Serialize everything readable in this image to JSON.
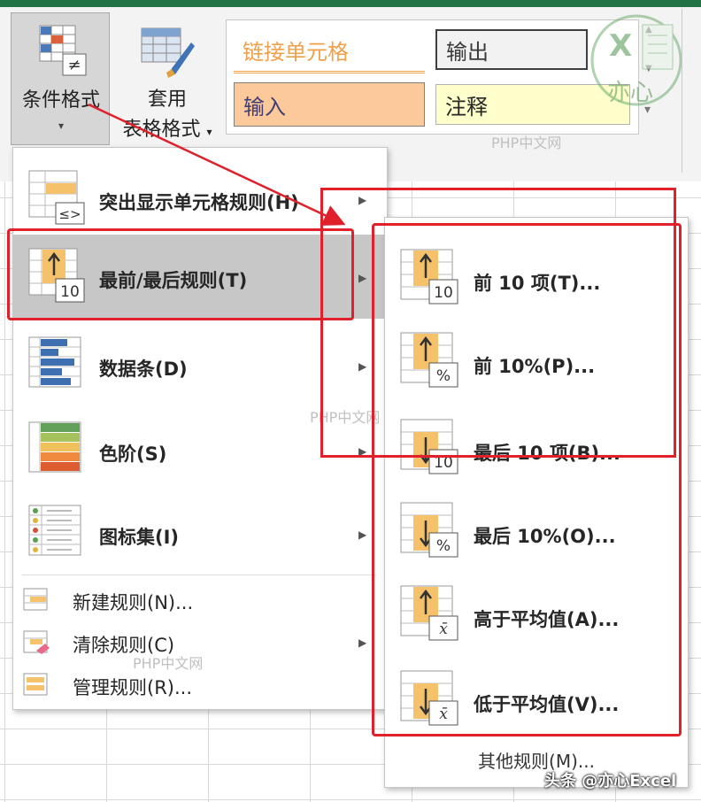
{
  "ribbon": {
    "conditional_format_label": "条件格式",
    "table_format_label_1": "套用",
    "table_format_label_2": "表格格式",
    "dropdown_caret": "▾",
    "styles": [
      {
        "label": "链接单元格",
        "bg": "#ffffff",
        "color": "#f4a34b"
      },
      {
        "label": "输出",
        "bg": "#f2f2f2",
        "color": "#3a3a3a"
      },
      {
        "label": "输入",
        "bg": "#fbc99a",
        "color": "#3f3f76"
      },
      {
        "label": "注释",
        "bg": "#ffffcc",
        "color": "#262626"
      }
    ],
    "scroll_up": "▲",
    "scroll_down": "▼",
    "more": "▾"
  },
  "menu": {
    "items": [
      {
        "label": "突出显示单元格规则(H)",
        "icon": "highlight-cells-rules-icon",
        "has_submenu": true
      },
      {
        "label": "最前/最后规则(T)",
        "icon": "top-bottom-rules-icon",
        "has_submenu": true,
        "highlighted": true
      },
      {
        "label": "数据条(D)",
        "icon": "data-bars-icon",
        "has_submenu": true
      },
      {
        "label": "色阶(S)",
        "icon": "color-scales-icon",
        "has_submenu": true
      },
      {
        "label": "图标集(I)",
        "icon": "icon-sets-icon",
        "has_submenu": true
      }
    ],
    "small_items": [
      {
        "label": "新建规则(N)...",
        "icon": "new-rule-icon",
        "has_submenu": false
      },
      {
        "label": "清除规则(C)",
        "icon": "clear-rules-icon",
        "has_submenu": true
      },
      {
        "label": "管理规则(R)...",
        "icon": "manage-rules-icon",
        "has_submenu": false
      }
    ],
    "arrow": "▶"
  },
  "submenu": {
    "items": [
      {
        "label": "前 10 项(T)...",
        "icon": "top-10-items-icon",
        "badge": "10"
      },
      {
        "label": "前 10%(P)...",
        "icon": "top-10-percent-icon",
        "badge": "%"
      },
      {
        "label": "最后 10 项(B)...",
        "icon": "bottom-10-items-icon",
        "badge": "10"
      },
      {
        "label": "最后 10%(O)...",
        "icon": "bottom-10-percent-icon",
        "badge": "%"
      },
      {
        "label": "高于平均值(A)...",
        "icon": "above-average-icon",
        "badge": "x̄"
      },
      {
        "label": "低于平均值(V)...",
        "icon": "below-average-icon",
        "badge": "x̄"
      }
    ],
    "footer": "其他规则(M)..."
  },
  "watermarks": {
    "site": "PHP中文网",
    "credit": "头条 @亦心Excel",
    "logo_text": "亦心",
    "logo_letter": "X"
  },
  "colors": {
    "highlight": "#c7c7c7",
    "annotation_red": "#e0202a",
    "excel_green": "#217346"
  }
}
